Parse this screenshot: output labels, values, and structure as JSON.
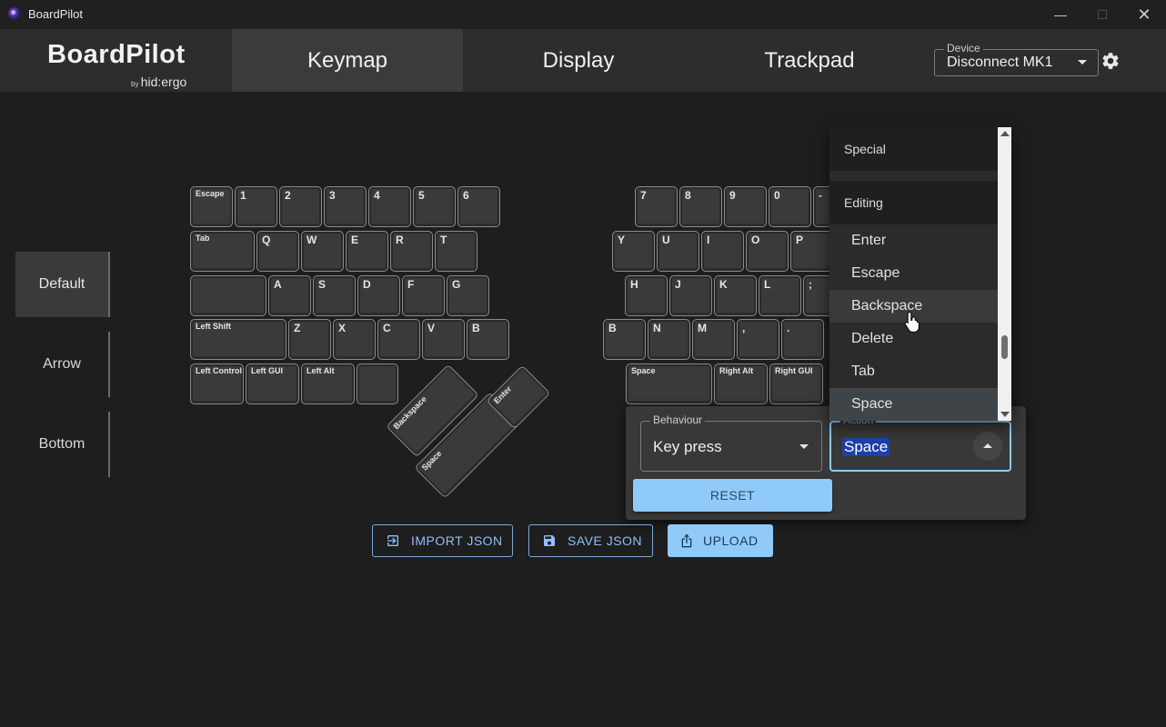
{
  "window": {
    "title": "BoardPilot"
  },
  "brand": {
    "name": "BoardPilot",
    "by": "by",
    "maker": "hid:ergo"
  },
  "tabs": [
    {
      "label": "Keymap",
      "active": true
    },
    {
      "label": "Display",
      "active": false
    },
    {
      "label": "Trackpad",
      "active": false
    }
  ],
  "device": {
    "label": "Device",
    "value": "Disconnect MK1"
  },
  "layers": [
    {
      "label": "Default",
      "active": true
    },
    {
      "label": "Arrow",
      "active": false
    },
    {
      "label": "Bottom",
      "active": false
    }
  ],
  "keys_left": [
    "Escape",
    "1",
    "2",
    "3",
    "4",
    "5",
    "6",
    "Tab",
    "Q",
    "W",
    "E",
    "R",
    "T",
    "",
    "A",
    "S",
    "D",
    "F",
    "G",
    "Left Shift",
    "Z",
    "X",
    "C",
    "V",
    "B",
    "Left Control",
    "Left GUI",
    "Left Alt",
    "",
    "Backspace",
    "Space",
    "Enter"
  ],
  "keys_right": [
    "7",
    "8",
    "9",
    "0",
    "-",
    "Y",
    "U",
    "I",
    "O",
    "P",
    "H",
    "J",
    "K",
    "L",
    ";",
    "B",
    "N",
    "M",
    ",",
    ".",
    "Space",
    "Right Alt",
    "Right GUI"
  ],
  "actions": {
    "import": "IMPORT JSON",
    "save": "SAVE JSON",
    "upload": "UPLOAD"
  },
  "editor": {
    "behaviour_label": "Behaviour",
    "behaviour_value": "Key press",
    "action_label": "Action",
    "action_value": "Space",
    "reset_label": "RESET"
  },
  "menu": {
    "groups": [
      "Special",
      "Editing"
    ],
    "items": [
      "Enter",
      "Escape",
      "Backspace",
      "Delete",
      "Tab",
      "Space"
    ],
    "hovered": "Backspace",
    "selected": "Space"
  },
  "colors": {
    "accent": "#90caf9",
    "background": "#1e1e1e",
    "header": "#2d2d2d"
  }
}
